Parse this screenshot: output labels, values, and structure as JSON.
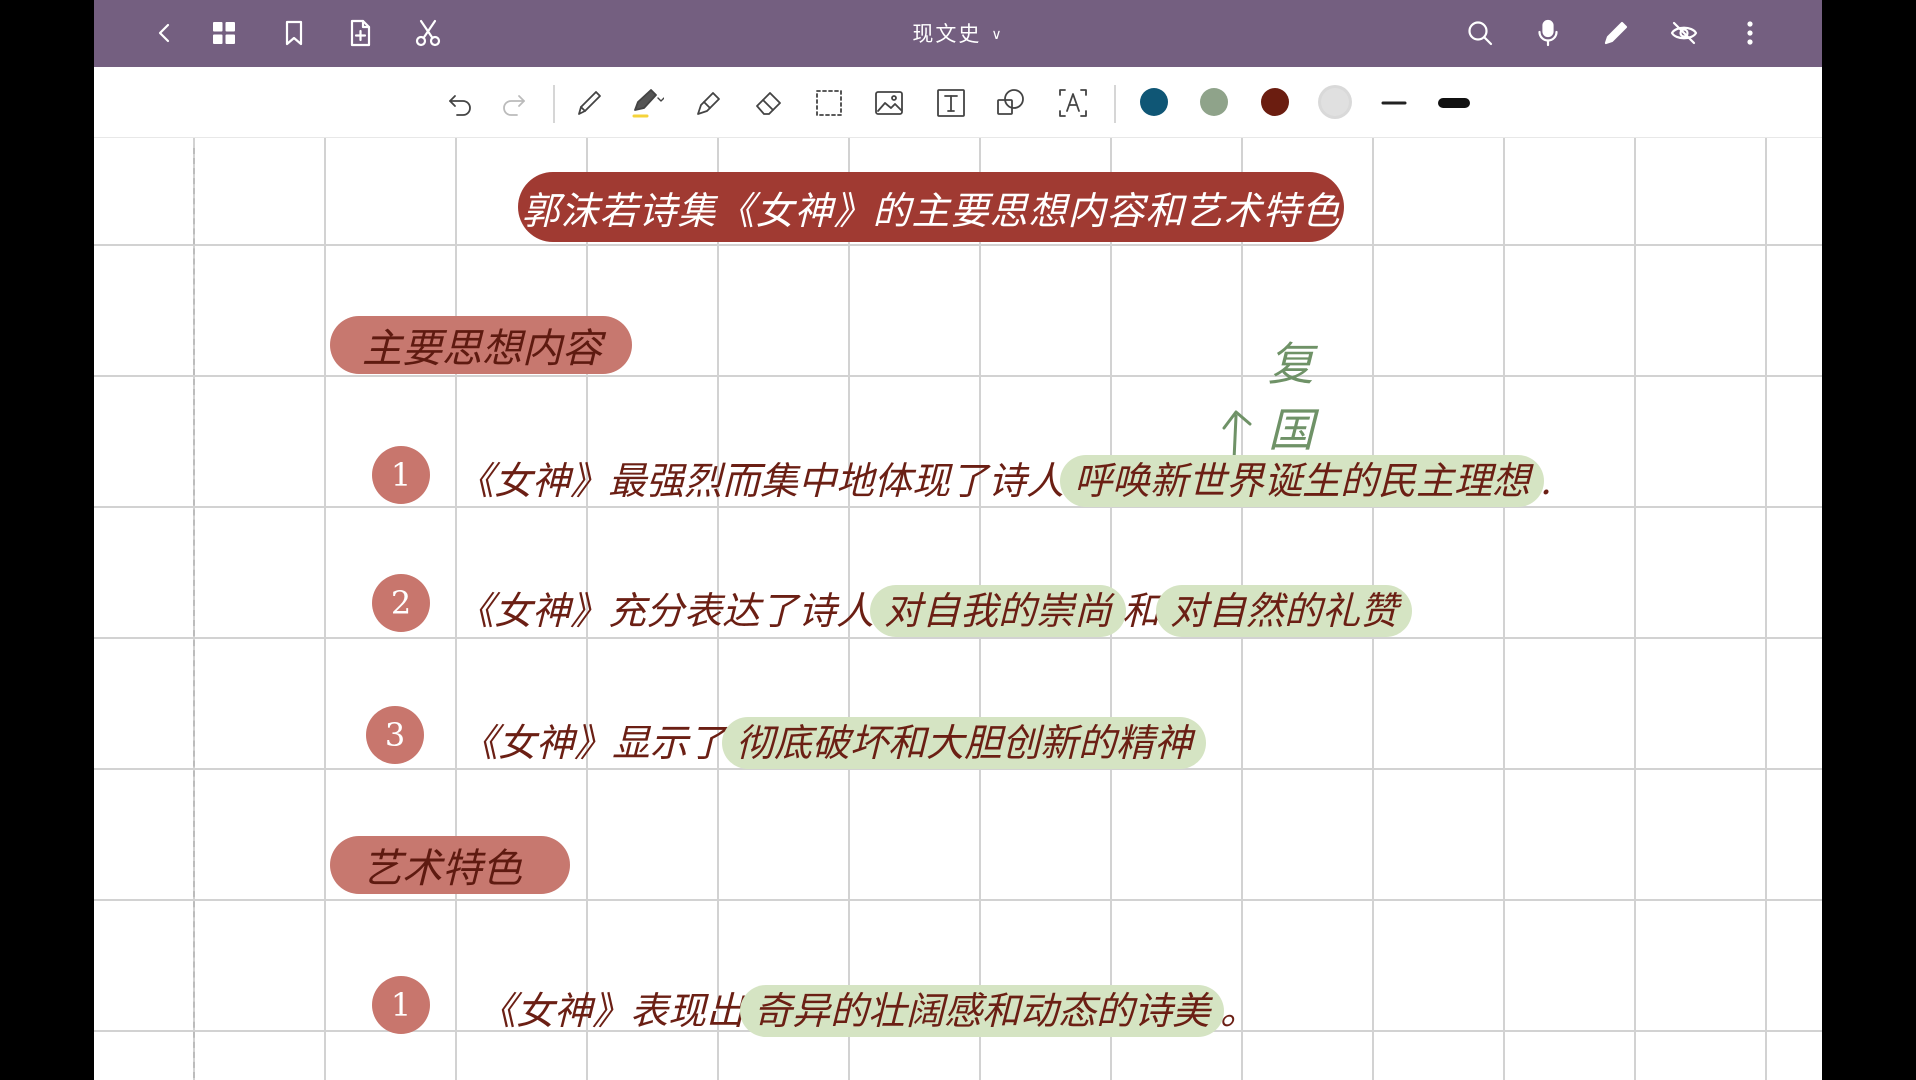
{
  "app": {
    "doc_title": "现文史",
    "top_icons_left": [
      "back-icon",
      "grid-icon",
      "bookmark-icon",
      "add-page-icon",
      "scissors-icon"
    ],
    "top_icons_right": [
      "search-icon",
      "mic-icon",
      "pen-icon",
      "hide-icon",
      "more-icon"
    ]
  },
  "toolbar": {
    "tools": [
      "undo-icon",
      "redo-icon",
      "pencil-icon",
      "fountain-pen-icon",
      "highlighter-icon",
      "eraser-icon",
      "lasso-select-icon",
      "image-icon",
      "text-box-icon",
      "shape-icon",
      "text-recognition-icon"
    ],
    "colors": [
      "#0f5675",
      "#8fa38a",
      "#6b1d10",
      "#e0e0e0"
    ],
    "pen_highlight_color": "#f5d33a"
  },
  "note": {
    "title": "郭沫若诗集《女神》的主要思想内容和艺术特色",
    "section1": "主要思想内容",
    "annotation": "复国",
    "items1": [
      {
        "num": "1",
        "pre": "《女神》最强烈而集中地体现了诗人",
        "hl": "呼唤新世界诞生的民主理想",
        "post": "."
      },
      {
        "num": "2",
        "pre": "《女神》充分表达了诗人",
        "hl": "对自我的崇尚",
        "mid": "和",
        "hl2": "对自然的礼赞"
      },
      {
        "num": "3",
        "pre": "《女神》显示了",
        "hl": "彻底破坏和大胆创新的精神"
      }
    ],
    "section2": "艺术特色",
    "items2": [
      {
        "num": "1",
        "pre": "《女神》表现出",
        "hl": "奇异的壮阔感和动态的诗美",
        "post": "。"
      }
    ]
  }
}
